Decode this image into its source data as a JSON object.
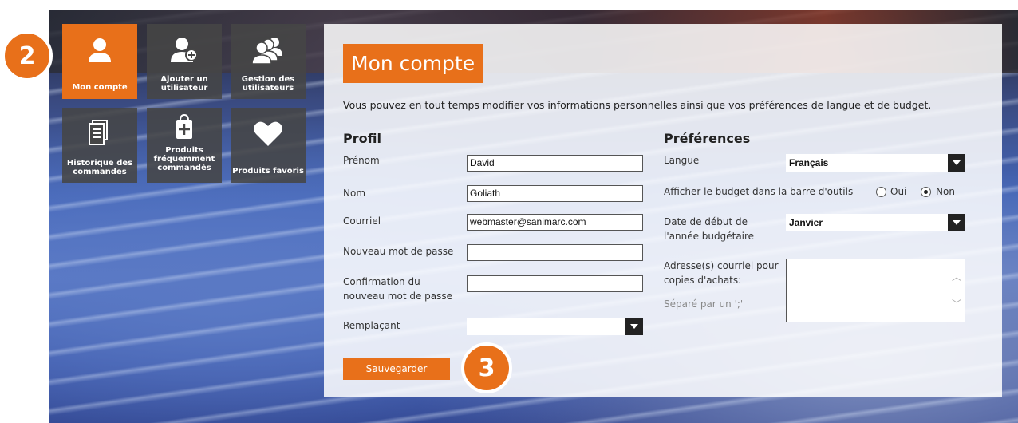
{
  "nav": {
    "tiles": [
      {
        "label": "Mon compte",
        "icon": "user-icon",
        "active": true
      },
      {
        "label": "Ajouter un utilisateur",
        "icon": "add-user-icon"
      },
      {
        "label": "Gestion des utilisateurs",
        "icon": "users-group-icon"
      },
      {
        "label": "Historique des commandes",
        "icon": "document-stack-icon"
      },
      {
        "label": "Produits fréquemment commandés",
        "icon": "shopping-bag-plus-icon"
      },
      {
        "label": "Produits favoris",
        "icon": "heart-icon"
      }
    ]
  },
  "badges": {
    "step2": "2",
    "step3": "3"
  },
  "page": {
    "title": "Mon compte",
    "intro": "Vous pouvez en tout temps modifier vos informations personnelles ainsi que vos préférences de langue et de budget."
  },
  "profil": {
    "heading": "Profil",
    "prenom_label": "Prénom",
    "prenom_value": "David",
    "nom_label": "Nom",
    "nom_value": "Goliath",
    "courriel_label": "Courriel",
    "courriel_value": "webmaster@sanimarc.com",
    "password_label": "Nouveau mot de passe",
    "password_value": "",
    "confirm_label_1": "Confirmation du",
    "confirm_label_2": "nouveau mot de passe",
    "confirm_value": "",
    "remplacant_label": "Remplaçant",
    "remplacant_value": ""
  },
  "preferences": {
    "heading": "Préférences",
    "langue_label": "Langue",
    "langue_value": "Français",
    "budget_label": "Afficher le budget dans la barre d'outils",
    "oui_label": "Oui",
    "non_label": "Non",
    "budget_selected": "Non",
    "date_label_1": "Date de début de",
    "date_label_2": "l'année budgétaire",
    "date_value": "Janvier",
    "emails_label_1": "Adresse(s) courriel pour",
    "emails_label_2": "copies d'achats:",
    "emails_hint": "Séparé par un ';'",
    "emails_value": ""
  },
  "actions": {
    "save_label": "Sauvegarder"
  },
  "colors": {
    "accent": "#e8701a",
    "tile": "#464646"
  }
}
